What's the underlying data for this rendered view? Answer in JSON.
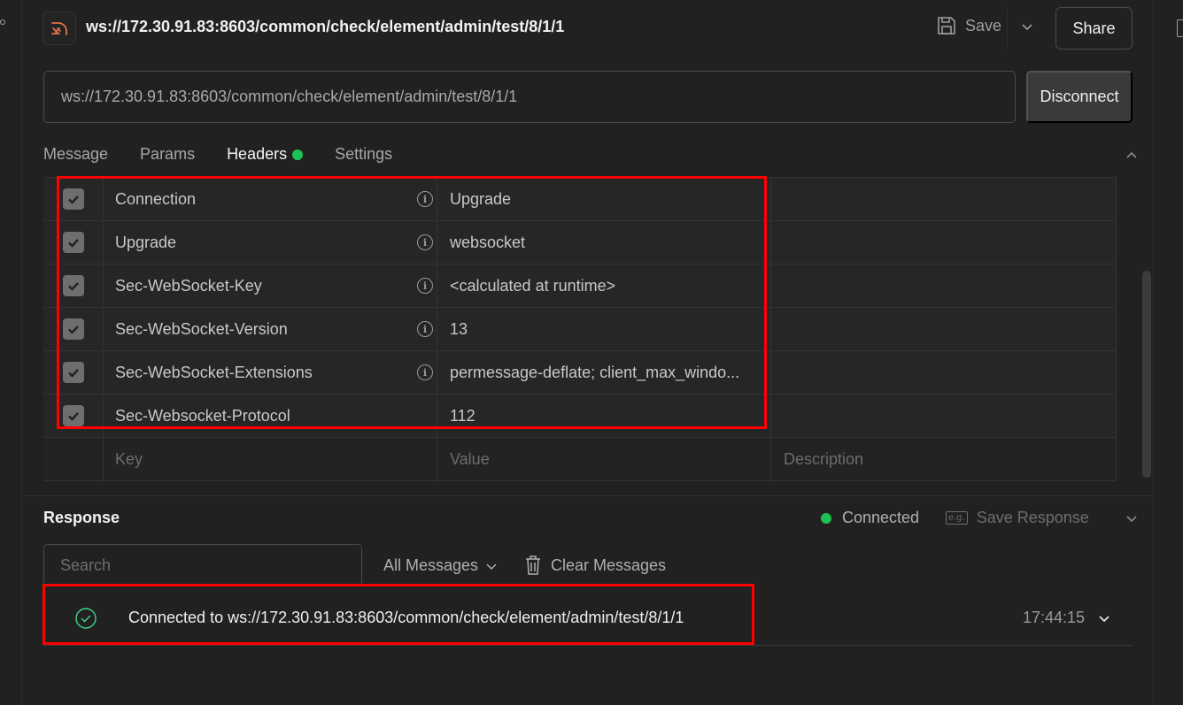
{
  "header": {
    "title": "ws://172.30.91.83:8603/common/check/element/admin/test/8/1/1",
    "save_label": "Save",
    "share_label": "Share"
  },
  "url_bar": {
    "value": "ws://172.30.91.83:8603/common/check/element/admin/test/8/1/1",
    "disconnect_label": "Disconnect"
  },
  "tabs": [
    {
      "label": "Message"
    },
    {
      "label": "Params"
    },
    {
      "label": "Headers",
      "active": true,
      "indicator": "green-dot"
    },
    {
      "label": "Settings"
    }
  ],
  "headers_table": {
    "rows": [
      {
        "checked": true,
        "key": "Connection",
        "info": true,
        "value": "Upgrade",
        "description": ""
      },
      {
        "checked": true,
        "key": "Upgrade",
        "info": true,
        "value": "websocket",
        "description": ""
      },
      {
        "checked": true,
        "key": "Sec-WebSocket-Key",
        "info": true,
        "value": "<calculated at runtime>",
        "description": ""
      },
      {
        "checked": true,
        "key": "Sec-WebSocket-Version",
        "info": true,
        "value": "13",
        "description": ""
      },
      {
        "checked": true,
        "key": "Sec-WebSocket-Extensions",
        "info": true,
        "value": "permessage-deflate; client_max_windo...",
        "description": ""
      },
      {
        "checked": true,
        "key": "Sec-Websocket-Protocol",
        "info": false,
        "value": "112",
        "description": ""
      }
    ],
    "placeholder": {
      "key": "Key",
      "value": "Value",
      "description": "Description"
    }
  },
  "response": {
    "title": "Response",
    "status": "Connected",
    "save_response_label": "Save Response",
    "save_response_icon": "e.g.",
    "search_placeholder": "Search",
    "filter_label": "All Messages",
    "clear_label": "Clear Messages",
    "messages": [
      {
        "text": "Connected to ws://172.30.91.83:8603/common/check/element/admin/test/8/1/1",
        "time": "17:44:15",
        "status": "success"
      }
    ]
  },
  "colors": {
    "accent_green": "#1dc254",
    "highlight_red": "#ff0000",
    "logo_orange": "#e8734a"
  }
}
